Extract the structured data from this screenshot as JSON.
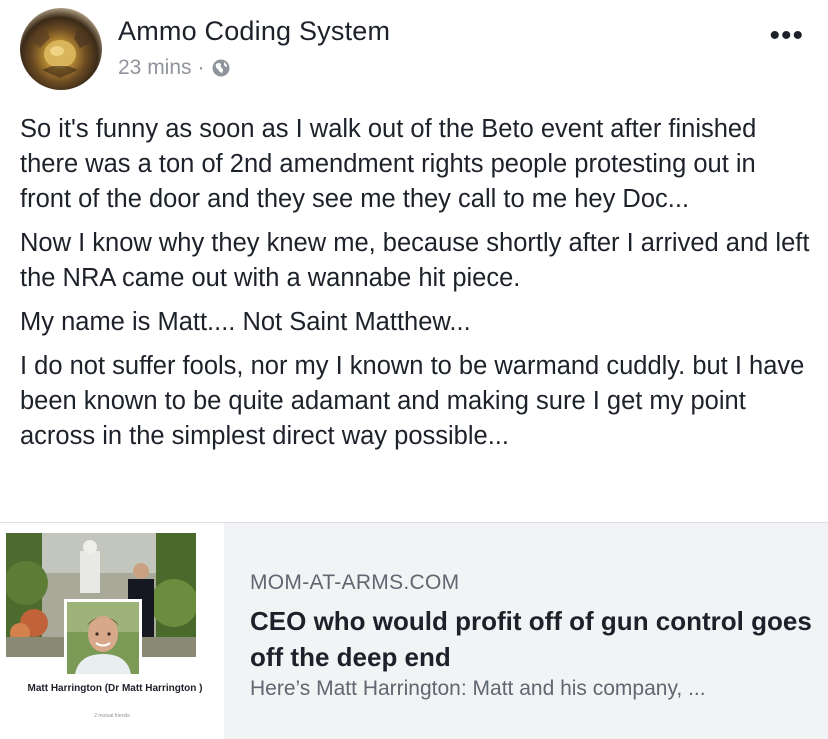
{
  "post": {
    "author": "Ammo Coding System",
    "time": "23 mins",
    "separator": "·",
    "privacy_icon": "globe-icon",
    "more_icon": "more-options-icon",
    "more_label": "•••",
    "paragraphs": [
      "So it's funny as soon as I walk out of the Beto event after finished there was a ton of 2nd amendment rights people protesting out in front of the door and they see me they call to me hey Doc...",
      "Now I know why they knew me, because shortly after I arrived and left the NRA came out with a wannabe hit piece.",
      "My name is Matt.... Not Saint Matthew...",
      "I do not suffer fools, nor my I known to be warmand cuddly. but I have been known to be quite adamant and making sure I get my point across in the simplest direct way possible..."
    ]
  },
  "link": {
    "thumbnail": {
      "name": "Matt Harrington (Dr Matt Harrington )",
      "mutual": "2 mutual friends"
    },
    "domain": "MOM-AT-ARMS.COM",
    "headline": "CEO who would profit off of gun control goes off the deep end",
    "description": "Here’s Matt Harrington: Matt and his company, ..."
  },
  "colors": {
    "text": "#1d2129",
    "meta": "#90949c",
    "card_bg": "#f2f3f5",
    "card_secondary": "#606770"
  }
}
